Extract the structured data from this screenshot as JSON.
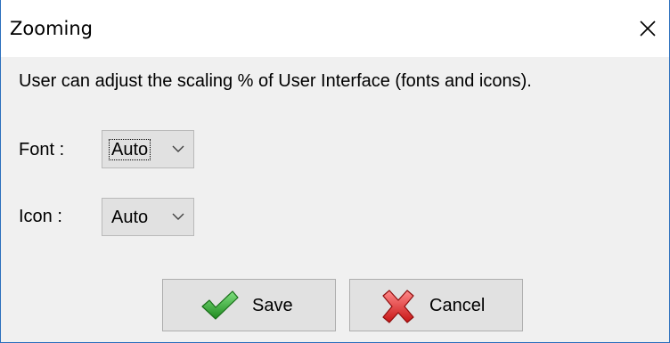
{
  "window": {
    "title": "Zooming",
    "close_icon": "close-icon"
  },
  "description": "User can adjust the scaling % of User Interface (fonts and icons).",
  "font_setting": {
    "label": "Font :",
    "value": "Auto"
  },
  "icon_setting": {
    "label": "Icon :",
    "value": "Auto"
  },
  "buttons": {
    "save": {
      "label": "Save",
      "icon": "checkmark-icon",
      "icon_color": "#2e9e2e"
    },
    "cancel": {
      "label": "Cancel",
      "icon": "red-x-icon",
      "icon_color": "#d92020"
    }
  },
  "colors": {
    "border_accent": "#2b6fbd",
    "dialog_background": "#f0f0f0"
  }
}
